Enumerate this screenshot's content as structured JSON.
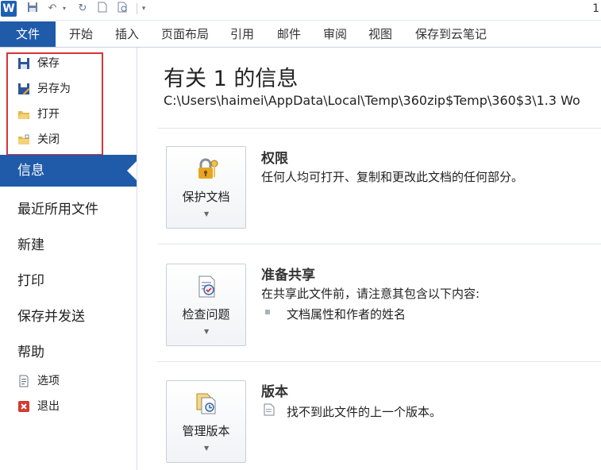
{
  "titlebar": {
    "app_logo": "W",
    "doc_title": "1"
  },
  "ribbon": {
    "file_tab": "文件",
    "tabs": [
      "开始",
      "插入",
      "页面布局",
      "引用",
      "邮件",
      "审阅",
      "视图",
      "保存到云笔记"
    ]
  },
  "backstage_nav": {
    "commands_top": [
      {
        "label": "保存",
        "icon": "save-icon"
      },
      {
        "label": "另存为",
        "icon": "save-as-icon"
      },
      {
        "label": "打开",
        "icon": "open-folder-icon"
      },
      {
        "label": "关闭",
        "icon": "close-folder-icon"
      }
    ],
    "selected_tab": "信息",
    "tabs": [
      "最近所用文件",
      "新建",
      "打印",
      "保存并发送",
      "帮助"
    ],
    "commands_bottom": [
      {
        "label": "选项",
        "icon": "options-icon"
      },
      {
        "label": "退出",
        "icon": "exit-icon"
      }
    ]
  },
  "info": {
    "title": "有关 1 的信息",
    "path": "C:\\Users\\haimei\\AppData\\Local\\Temp\\360zip$Temp\\360$3\\1.3 Wo",
    "sections": [
      {
        "button_label": "保护文档",
        "icon": "lock-key-icon",
        "heading": "权限",
        "description": "任何人均可打开、复制和更改此文档的任何部分。"
      },
      {
        "button_label": "检查问题",
        "icon": "inspect-document-icon",
        "heading": "准备共享",
        "description": "在共享此文件前，请注意其包含以下内容:",
        "bullets": [
          "文档属性和作者的姓名"
        ]
      },
      {
        "button_label": "管理版本",
        "icon": "manage-versions-icon",
        "heading": "版本",
        "description": "找不到此文件的上一个版本。"
      }
    ]
  },
  "colors": {
    "accent": "#1f5ba8",
    "highlight_box": "#d6343b"
  }
}
